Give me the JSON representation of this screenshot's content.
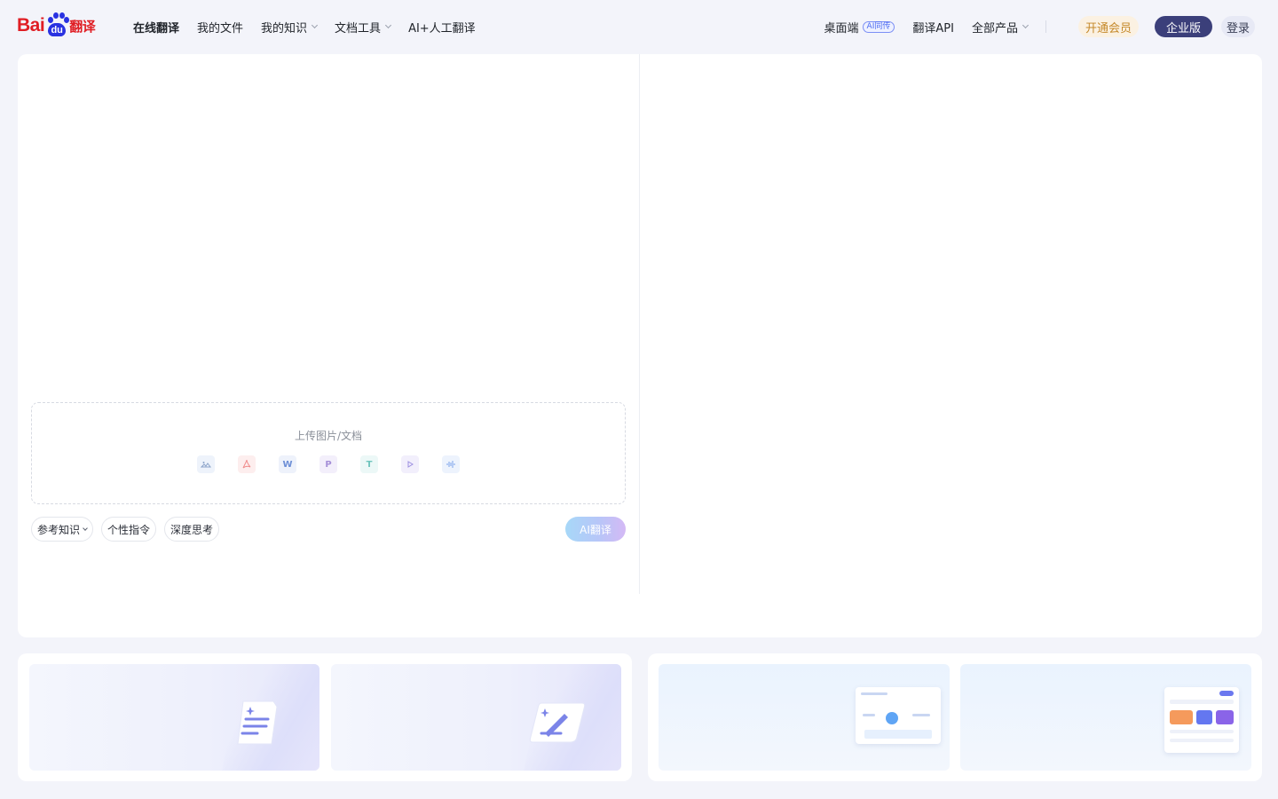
{
  "header": {
    "logo": {
      "bai": "Bai",
      "du": "du",
      "fanyi": "翻译"
    },
    "nav": [
      {
        "label": "在线翻译",
        "active": true,
        "dropdown": false
      },
      {
        "label": "我的文件",
        "active": false,
        "dropdown": false
      },
      {
        "label": "我的知识",
        "active": false,
        "dropdown": true
      },
      {
        "label": "文档工具",
        "active": false,
        "dropdown": true
      },
      {
        "label": "AI+人工翻译",
        "active": false,
        "dropdown": false
      }
    ],
    "right": {
      "desktop": "桌面端",
      "desktop_badge": "AI同传",
      "api": "翻译API",
      "all_products": "全部产品",
      "vip": "开通会员",
      "enterprise": "企业版",
      "login": "登录"
    }
  },
  "input_panel": {
    "upload_title": "上传图片/文档",
    "file_icons": [
      "image-icon",
      "pdf-icon",
      "word-icon",
      "ppt-icon",
      "text-icon",
      "video-icon",
      "audio-icon"
    ],
    "chips": {
      "knowledge": "参考知识",
      "instruction": "个性指令",
      "deep_think": "深度思考"
    },
    "translate_button": "AI翻译"
  },
  "colors": {
    "brand_red": "#e01e24",
    "brand_blue": "#2932e1",
    "enterprise_bg": "#3b3f7a",
    "vip_text": "#c5892a"
  }
}
